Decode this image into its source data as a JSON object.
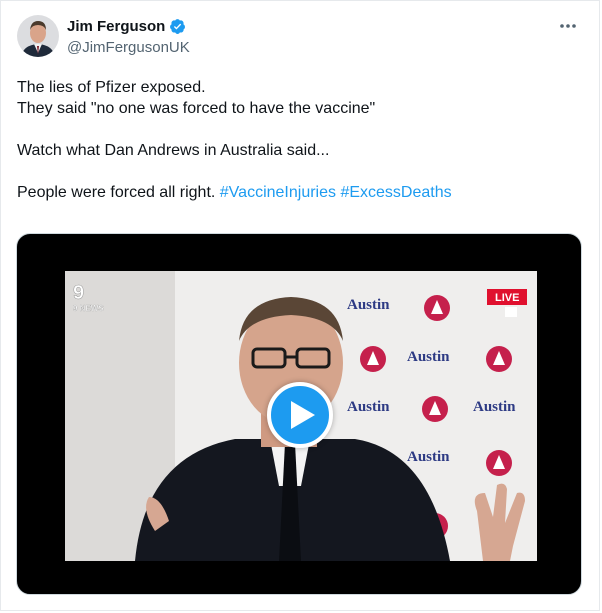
{
  "author": {
    "name": "Jim Ferguson",
    "handle": "@JimFergusonUK",
    "verified": true
  },
  "tweet": {
    "line1": "The lies of Pfizer exposed.",
    "line2": "They said \"no one was forced to have the vaccine\"",
    "line3": "Watch what Dan Andrews in Australia said...",
    "line4_text": "People were forced all right. ",
    "hashtags": [
      "#VaccineInjuries",
      "#ExcessDeaths"
    ]
  },
  "video": {
    "channel_logo": "9 NEWS",
    "live_badge": "LIVE",
    "backdrop_text": "Austin"
  },
  "icons": {
    "verified": "verified-badge-icon",
    "more": "more-options-icon",
    "play": "play-icon"
  },
  "colors": {
    "accent": "#1d9bf0",
    "text": "#0f1419",
    "secondary": "#536471",
    "live_red": "#e0102e",
    "austin_blue": "#2d3a84"
  }
}
